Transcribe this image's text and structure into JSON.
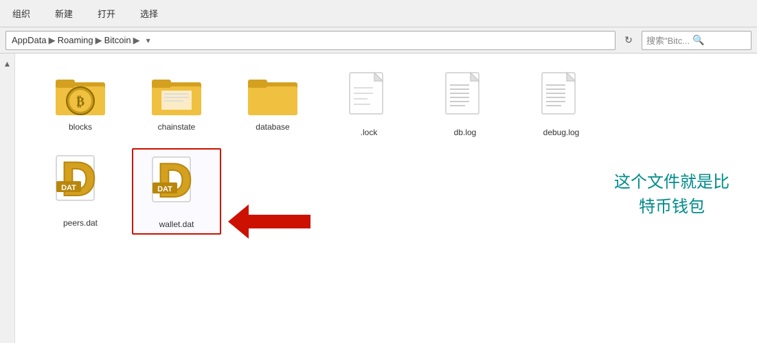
{
  "toolbar": {
    "buttons": [
      "组织",
      "新建",
      "打开",
      "选择"
    ]
  },
  "address": {
    "parts": [
      "AppData",
      "Roaming",
      "Bitcoin"
    ],
    "search_placeholder": "搜索\"Bitc... ρ"
  },
  "files": [
    {
      "name": "blocks",
      "type": "bitcoin-folder",
      "label": "blocks"
    },
    {
      "name": "chainstate",
      "type": "plain-folder",
      "label": "chainstate"
    },
    {
      "name": "database",
      "type": "plain-folder",
      "label": "database"
    },
    {
      "name": ".lock",
      "type": "generic-file",
      "label": ".lock"
    },
    {
      "name": "db.log",
      "type": "log-file",
      "label": "db.log"
    },
    {
      "name": "debug.log",
      "type": "log-file",
      "label": "debug.log"
    },
    {
      "name": "peers.dat",
      "type": "dat-file",
      "label": "peers.dat"
    },
    {
      "name": "wallet.dat",
      "type": "dat-file",
      "label": "wallet.dat",
      "selected": true
    }
  ],
  "annotation": {
    "text": "这个文件就是比\n特币钱包"
  }
}
